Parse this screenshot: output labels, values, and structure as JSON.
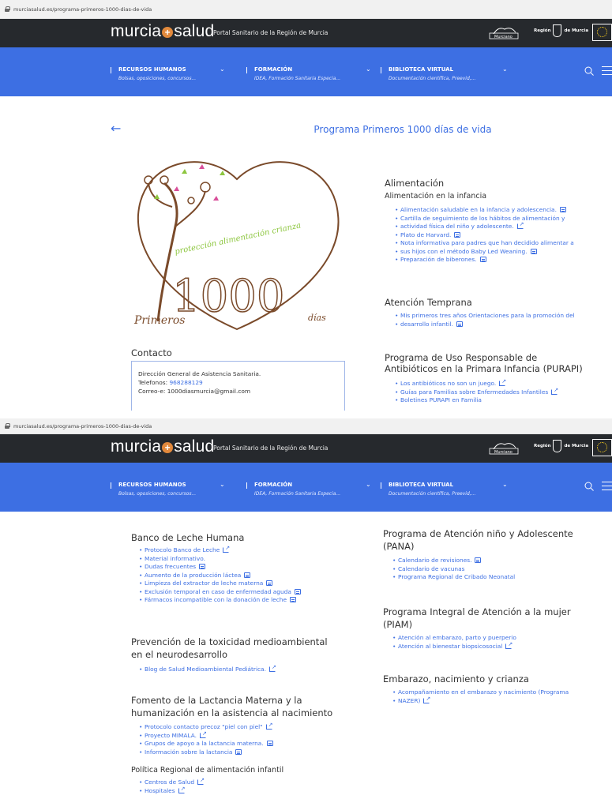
{
  "browser": {
    "url": "murciasalud.es/programa-primeros-1000-dias-de-vida"
  },
  "header": {
    "brand_left": "murcia",
    "brand_plus": "+",
    "brand_right": "salud",
    "tagline": "Portal Sanitario de la Región de Murcia",
    "partner_logo_text": "Murciano",
    "region_text_1": "Región",
    "region_text_2": "de Murcia"
  },
  "nav": {
    "items": [
      {
        "label": "RECURSOS HUMANOS",
        "sub": "Bolsas, oposiciones, concursos..."
      },
      {
        "label": "FORMACIÓN",
        "sub": "IDEA, Formación Sanitaria Especia..."
      },
      {
        "label": "BIBLIOTECA VIRTUAL",
        "sub": "Documentación científica, Preevid,..."
      }
    ]
  },
  "page": {
    "title": "Programa Primeros 1000 días de vida"
  },
  "hero": {
    "primeros": "Primeros",
    "big_number": "1000",
    "dias": "días",
    "arc_words": "protección alimentación crianza"
  },
  "alimentacion": {
    "title": "Alimentación",
    "subtitle": "Alimentación en la infancia",
    "links": [
      "Alimentación saludable en la infancia y adolescencia.",
      "Cartilla de seguimiento de los hábitos de alimentación y",
      "actividad física del niño y adolescente.",
      "Plato de Harvard.",
      "Nota informativa para padres que han decidido alimentar a",
      "sus hijos con el método Baby Led Weaning.",
      "Preparación de biberones."
    ]
  },
  "atencion": {
    "title": "Atención Temprana",
    "links": [
      "Mis primeros tres años Orientaciones para la promoción del",
      "desarrollo infantil."
    ]
  },
  "purapi": {
    "title_1": "Programa de Uso Responsable de",
    "title_2": "Antibióticos en la Primara Infancia (PURAPI)",
    "links": [
      "Los antibióticos no son un juego.",
      "Guías para Familias sobre Enfermedades Infantiles",
      "Boletines PURAPI en Familia"
    ]
  },
  "contact": {
    "title": "Contacto",
    "line1": "Dirección General de Asistencia Sanitaria.",
    "tel_label": "Telefonos: ",
    "tel_value": "968288129",
    "email": "Correo-e: 1000diasmurcia@gmail.com"
  },
  "banco": {
    "title": "Banco de Leche Humana",
    "links": [
      "Protocolo Banco de Leche",
      "Material informativo.",
      "Dudas frecuentes",
      "Aumento de la producción láctea",
      "Limpieza del extractor de leche materna",
      "Exclusión temporal en caso de enfermedad aguda",
      "Fármacos incompatible con la donación de leche"
    ]
  },
  "prevencion": {
    "title_1": "Prevención de la toxicidad medioambiental",
    "title_2": "en el neurodesarrollo",
    "links": [
      "Blog de Salud Medioambiental Pediátrica."
    ]
  },
  "fomento": {
    "title_1": "Fomento de la Lactancia Materna y la",
    "title_2": "humanización en la asistencia al nacimiento",
    "links": [
      "Protocolo contacto precoz \"piel con piel\"",
      "Proyecto MIMALA.",
      "Grupos de apoyo a la lactancia materna.",
      "Información sobre la lactancia"
    ]
  },
  "politica": {
    "title": "Política Regional de alimentación infantil",
    "links": [
      "Centros de Salud",
      "Hospitales"
    ]
  },
  "pana": {
    "title_1": "Programa de Atención niño y Adolescente",
    "title_2": "(PANA)",
    "links": [
      "Calendario de revisiones.",
      "Calendario de vacunas",
      "Programa Regional de Cribado Neonatal"
    ]
  },
  "piam": {
    "title_1": "Programa Integral de Atención a la mujer",
    "title_2": "(PIAM)",
    "links": [
      "Atención al embarazo, parto y puerperio",
      "Atención al bienestar biopsicosocial"
    ]
  },
  "embarazo": {
    "title": "Embarazo, nacimiento y crianza",
    "links": [
      "Acompañamiento en el embarazo y nacimiento (Programa",
      "NAZER)"
    ]
  },
  "colors": {
    "nav_blue": "#3d6fe3",
    "topbar_dark": "#26292d",
    "brand_orange": "#e2893c",
    "hero_brown": "#7a4a2a",
    "hero_green": "#8dc63f",
    "hero_pink": "#d94f9a"
  }
}
